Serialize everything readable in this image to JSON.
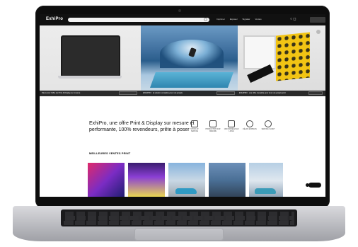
{
  "nav": {
    "logo": "ExhiPro",
    "links": [
      "Imprimer",
      "Exposer",
      "Signaler",
      "Ventes",
      "Fixer"
    ],
    "icons": [
      "search-icon",
      "account-icon",
      "cart-icon"
    ]
  },
  "hero": {
    "captions": [
      "Découvrez l'offre de Print & Display sur mesure",
      "EXHIPRO : la solution complète pour vos projets",
      "EXHIPRO : une offre complète pour tous vos projets print"
    ]
  },
  "headline": "ExhiPro, une offre Print & Display sur mesure et performante, 100% revendeurs, prête à poser",
  "features": [
    {
      "icon": "building-icon",
      "label": "STOCK ET SERVICE"
    },
    {
      "icon": "printer-icon",
      "label": "PRODUCTION SUR MESURE"
    },
    {
      "icon": "document-icon",
      "label": "1000 MODÈLES EN LIGNE"
    },
    {
      "icon": "timer-icon",
      "label": "DÉLAIS EXPRESS"
    },
    {
      "icon": "globe-icon",
      "label": "SERVICE CLIENT"
    }
  ],
  "bestsellers_title": "MEILLEURES VENTES PRINT",
  "colors": {
    "nav": "#111111",
    "accent": "#f2c414"
  }
}
